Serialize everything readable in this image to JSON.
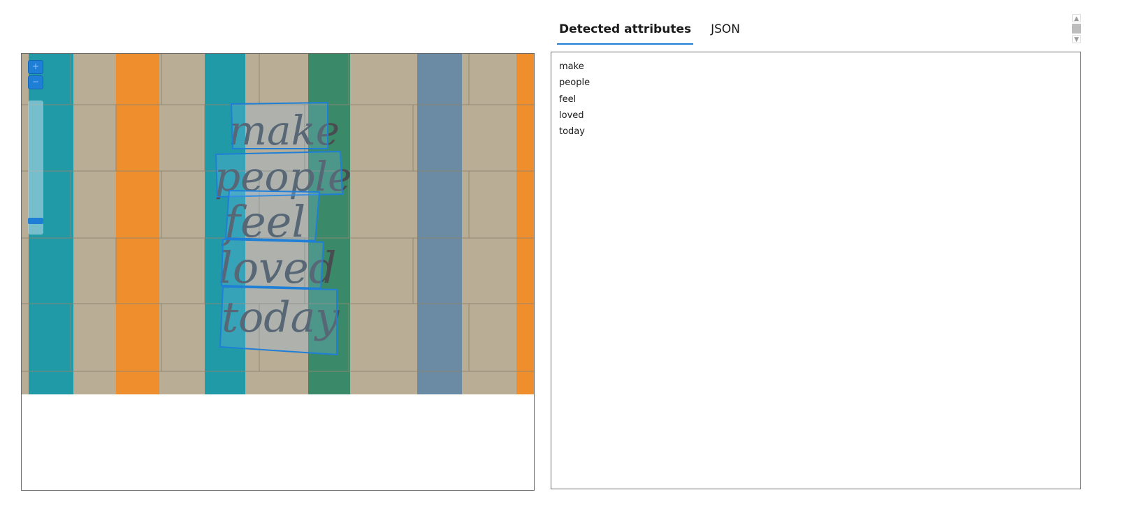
{
  "tabs": [
    {
      "label": "Detected attributes",
      "active": true
    },
    {
      "label": "JSON",
      "active": false
    }
  ],
  "viewer": {
    "zoom_in_label": "+",
    "zoom_out_label": "−",
    "zoom_level": 0.12,
    "image_words": [
      "make",
      "people",
      "feel",
      "loved",
      "today"
    ]
  },
  "attributes": [
    "make",
    "people",
    "feel",
    "loved",
    "today"
  ],
  "colors": {
    "accent": "#1f7fd6",
    "wall": "#b9ad95",
    "teal": "#1f9aa6",
    "orange": "#ef8e2d",
    "green": "#3a8a6a",
    "slate": "#6b8aa3",
    "ink": "#4a4d50"
  },
  "icons": {
    "scroll_up": "chevron-up-icon",
    "scroll_down": "chevron-down-icon"
  }
}
